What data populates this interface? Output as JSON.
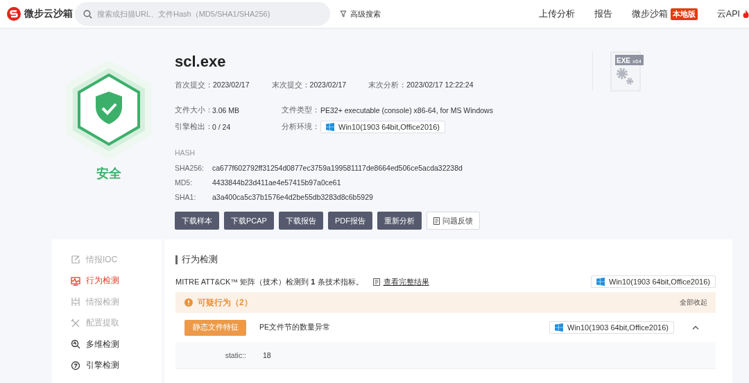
{
  "header": {
    "logo": "微步云沙箱",
    "search": {
      "placeholder": "搜索或扫描URL、文件Hash（MD5/SHA1/SHA256)"
    },
    "advanced_search": "高级搜索",
    "nav": [
      {
        "label": "上传分析"
      },
      {
        "label": "报告"
      },
      {
        "label": "微步沙箱",
        "badge": "本地版"
      },
      {
        "label": "云API",
        "hot": true
      }
    ]
  },
  "summary": {
    "verdict": {
      "label": "安全",
      "kind": "safe"
    },
    "file_name": "scl.exe",
    "dates": [
      {
        "label": "首次提交：",
        "value": "2023/02/17"
      },
      {
        "label": "末次提交：",
        "value": "2023/02/17"
      },
      {
        "label": "末次分析：",
        "value": "2023/02/17 12:22:24"
      }
    ],
    "details": [
      {
        "label": "文件大小：",
        "value": "3.06 MB"
      },
      {
        "label": "文件类型：",
        "value": "PE32+ executable (console) x86-64, for MS Windows"
      },
      {
        "label": "引擎检出：",
        "value": "0 / 24"
      },
      {
        "label": "分析环境：",
        "value": "Win10(1903 64bit,Office2016)",
        "kind": "env"
      }
    ],
    "hash": {
      "title": "HASH",
      "rows": [
        {
          "label": "SHA256:",
          "value": "ca677f602792ff31254d0877ec3759a199581117de8664ed506ce5acda32238d"
        },
        {
          "label": "MD5:",
          "value": "4433844b23d411ae4e57415b97a0ce61"
        },
        {
          "label": "SHA1:",
          "value": "a3a400ca5c37b1576e4d2be55db3283d8c6b5929"
        }
      ]
    },
    "buttons": [
      {
        "label": "下载样本",
        "kind": "dark"
      },
      {
        "label": "下载PCAP",
        "kind": "dark"
      },
      {
        "label": "下载报告",
        "kind": "dark"
      },
      {
        "label": "PDF报告",
        "kind": "dark"
      },
      {
        "label": "重新分析",
        "kind": "dark"
      },
      {
        "label": "问题反馈",
        "kind": "outline"
      }
    ],
    "file_icon": {
      "label": "EXE",
      "sub": "x64"
    }
  },
  "sidebar": {
    "items": [
      {
        "label": "情报IOC",
        "selected": false,
        "disabled": true
      },
      {
        "label": "行为检测",
        "selected": true,
        "disabled": false
      },
      {
        "label": "情报检测",
        "selected": false,
        "disabled": true
      },
      {
        "label": "配置提取",
        "selected": false,
        "disabled": true
      },
      {
        "label": "多维检测",
        "selected": false,
        "disabled": false
      },
      {
        "label": "引擎检测",
        "selected": false,
        "disabled": false
      }
    ]
  },
  "behavior": {
    "title": "行为检测",
    "summary": "MITRE ATT&CK™ 矩阵（技术）检测到 **1** 条技术指标。",
    "link": "查看完整结果",
    "env": "Win10(1903 64bit,Office2016)",
    "group": {
      "title": "可疑行为（2）",
      "action": "全部收起",
      "items": [
        {
          "tag": "静态文件特征",
          "description": "PE文件节的数量异常",
          "env": "Win10(1903 64bit,Office2016)",
          "expanded": true,
          "details": [
            {
              "key": "static::",
              "value": "18"
            }
          ]
        }
      ]
    }
  }
}
